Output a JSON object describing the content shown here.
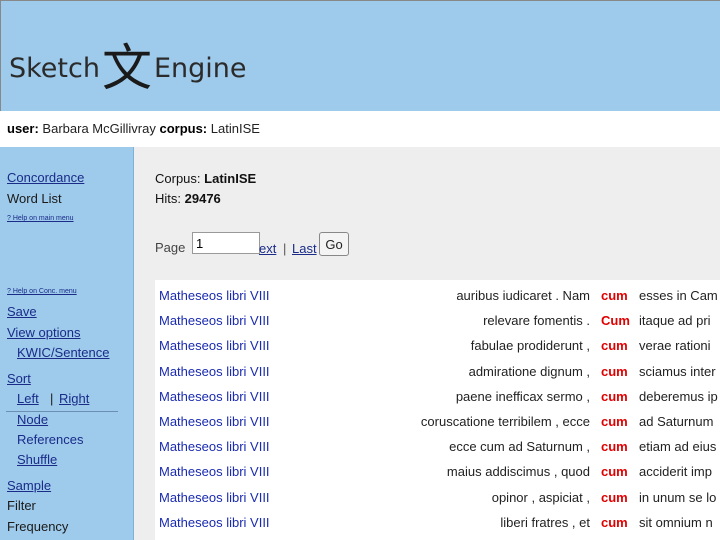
{
  "app": {
    "logo_left": "Sketch",
    "logo_glyph": "文",
    "logo_right": "Engine"
  },
  "userbar": {
    "user_label": "user:",
    "user_name": "Barbara McGillivray",
    "corpus_label": "corpus:",
    "corpus_name": "LatinISE"
  },
  "sidebar": {
    "concordance": "Concordance",
    "word_list": "Word List",
    "help_main_menu": "? Help on main menu",
    "help_conc_menu": "? Help on Conc. menu",
    "save": "Save",
    "view_options": "View options",
    "kwic_sentence": "KWIC/Sentence",
    "sort": "Sort",
    "left": "Left",
    "sort_sep": "|",
    "right": "Right",
    "node": "Node",
    "references": "References",
    "shuffle": "Shuffle",
    "sample": "Sample",
    "filter": "Filter",
    "frequency": "Frequency"
  },
  "main": {
    "corpus_label": "Corpus:",
    "corpus_value": "LatinISE",
    "hits_label": "Hits:",
    "hits_value": "29476"
  },
  "pager": {
    "page_label": "Page",
    "page_value": "1",
    "next_label": "ext",
    "sep": "|",
    "last_label": "Last",
    "go_label": "Go"
  },
  "concordance": {
    "rows": [
      {
        "doc": "Matheseos libri VIII",
        "left": "auribus iudicaret . Nam",
        "kwic": "cum",
        "right": "esses in Cam"
      },
      {
        "doc": "Matheseos libri VIII",
        "left": "relevare fomentis .",
        "kwic": "Cum",
        "right": "itaque ad pri"
      },
      {
        "doc": "Matheseos libri VIII",
        "left": "fabulae prodiderunt ,",
        "kwic": "cum",
        "right": "verae rationi"
      },
      {
        "doc": "Matheseos libri VIII",
        "left": "admiratione dignum ,",
        "kwic": "cum",
        "right": "sciamus inter"
      },
      {
        "doc": "Matheseos libri VIII",
        "left": "paene inefficax sermo ,",
        "kwic": "cum",
        "right": "deberemus ip"
      },
      {
        "doc": "Matheseos libri VIII",
        "left": "coruscatione terribilem , ecce",
        "kwic": "cum",
        "right": "ad Saturnum"
      },
      {
        "doc": "Matheseos libri VIII",
        "left": "ecce cum ad Saturnum ,",
        "kwic": "cum",
        "right": "etiam ad eius"
      },
      {
        "doc": "Matheseos libri VIII",
        "left": "maius addiscimus , quod",
        "kwic": "cum",
        "right": "acciderit imp"
      },
      {
        "doc": "Matheseos libri VIII",
        "left": "opinor , aspiciat ,",
        "kwic": "cum",
        "right": "in unum se lo"
      },
      {
        "doc": "Matheseos libri VIII",
        "left": "liberi fratres , et",
        "kwic": "cum",
        "right": "sit omnium n"
      }
    ]
  },
  "colors": {
    "header_bg": "#9ecbec",
    "link": "#1a2bb0",
    "kwic": "#e00000"
  }
}
